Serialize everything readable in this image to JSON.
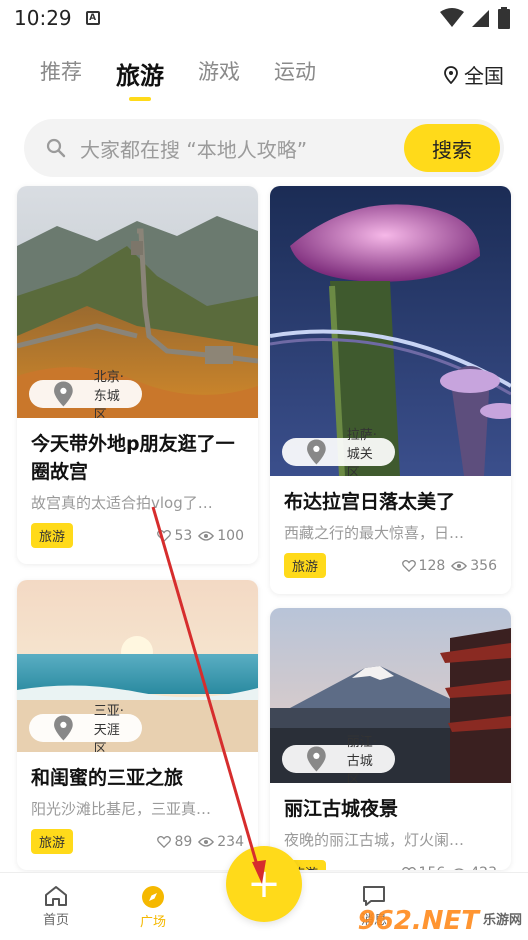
{
  "status_bar": {
    "time": "10:29",
    "notification_icon": "A"
  },
  "tabs": [
    {
      "label": "推荐",
      "active": false
    },
    {
      "label": "旅游",
      "active": true
    },
    {
      "label": "游戏",
      "active": false
    },
    {
      "label": "运动",
      "active": false
    }
  ],
  "region": {
    "label": "全国",
    "icon": "location-pin-icon"
  },
  "search": {
    "placeholder": "大家都在搜 “本地人攻略”",
    "button_label": "搜索"
  },
  "cards": [
    {
      "location": "北京·东城区",
      "title": "今天带外地p朋友逛了一圈故宫",
      "desc": "故宫真的太适合拍vlog了…",
      "tag": "旅游",
      "likes": "53",
      "views": "100"
    },
    {
      "location": "拉萨·城关区",
      "title": "布达拉宫日落太美了",
      "desc": "西藏之行的最大惊喜，日…",
      "tag": "旅游",
      "likes": "128",
      "views": "356"
    },
    {
      "location": "三亚·天涯区",
      "title": "和闺蜜的三亚之旅",
      "desc": "阳光沙滩比基尼，三亚真…",
      "tag": "旅游",
      "likes": "89",
      "views": "234"
    },
    {
      "location": "丽江·古城区",
      "title": "丽江古城夜景",
      "desc": "夜晚的丽江古城，灯火阑…",
      "tag": "旅游",
      "likes": "156",
      "views": "423"
    }
  ],
  "bottom_nav": {
    "home": "首页",
    "square": "广场",
    "messages": "消息",
    "fab": "+"
  },
  "colors": {
    "accent": "#FFDA1A",
    "active_nav": "#F5B800"
  },
  "watermark": {
    "big": "962.NET",
    "small": "乐游网"
  }
}
